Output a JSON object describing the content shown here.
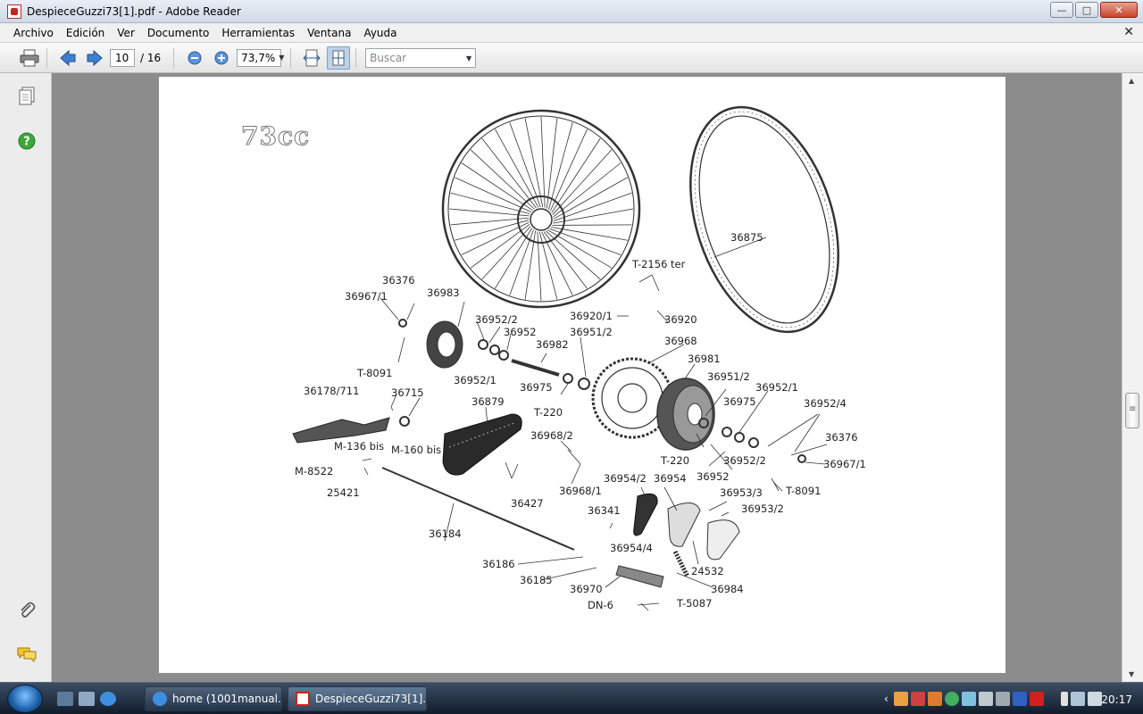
{
  "window": {
    "title": "DespieceGuzzi73[1].pdf - Adobe Reader"
  },
  "menu": [
    "Archivo",
    "Edición",
    "Ver",
    "Documento",
    "Herramientas",
    "Ventana",
    "Ayuda"
  ],
  "toolbar": {
    "page_current": "10",
    "page_total": "/ 16",
    "zoom": "73,7%",
    "search_placeholder": "Buscar"
  },
  "document": {
    "heading": "73cc",
    "part_labels": [
      "36875",
      "T-2156 ter",
      "36920/1",
      "36920",
      "36968",
      "36951/2",
      "36981",
      "36376",
      "36967/1",
      "36983",
      "36952/2",
      "36952",
      "36982",
      "T-8091",
      "36952/1",
      "36975",
      "T-220",
      "36178/711",
      "36715",
      "36879",
      "36968/2",
      "M-136 bis",
      "M-160 bis",
      "M-8522",
      "25421",
      "36427",
      "36968/1",
      "36954/2",
      "36954",
      "36953/3",
      "36953/2",
      "36341",
      "36184",
      "36954/4",
      "24532",
      "36186",
      "36185",
      "36970",
      "36984",
      "DN-6",
      "T-5087",
      "36951/2",
      "36952/1",
      "36952/4",
      "36975",
      "36376",
      "36967/1",
      "T-220",
      "36952/2",
      "36952",
      "T-8091"
    ]
  },
  "taskbar": {
    "tasks": [
      "home (1001manual...",
      "DespieceGuzzi73[1]...."
    ],
    "clock": "20:17"
  },
  "colors": {
    "acrobat_red": "#c8241d",
    "nav_green": "#3aa83a",
    "toolbar_active": "#bcd2ea"
  }
}
